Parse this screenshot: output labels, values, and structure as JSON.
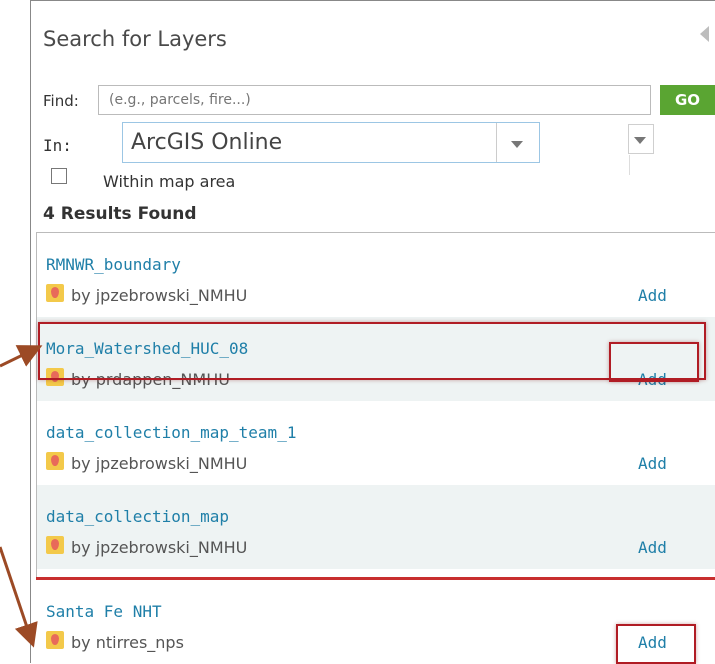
{
  "panel": {
    "title": "Search for Layers",
    "find_label": "Find:",
    "find_placeholder": "(e.g., parcels, fire...)",
    "go_label": "GO",
    "in_label": "In:",
    "in_selected": "ArcGIS Online",
    "within_map_area_label": "Within map area",
    "within_map_area_checked": false,
    "results_count_label": "4 Results Found"
  },
  "results": [
    {
      "title": "RMNWR_boundary",
      "owner": "by jpzebrowski_NMHU",
      "add_label": "Add"
    },
    {
      "title": "Mora_Watershed_HUC_08",
      "owner": "by prdappen_NMHU",
      "add_label": "Add"
    },
    {
      "title": "data_collection_map_team_1",
      "owner": "by jpzebrowski_NMHU",
      "add_label": "Add"
    },
    {
      "title": "data_collection_map",
      "owner": "by jpzebrowski_NMHU",
      "add_label": "Add"
    }
  ],
  "extra_result": {
    "title": "Santa Fe NHT",
    "owner": "by ntirres_nps",
    "add_label": "Add"
  },
  "colors": {
    "accent_link": "#1f7fa8",
    "go_button": "#5aa532",
    "highlight": "#b01c24",
    "arrow": "#9c4a25"
  },
  "icons": {
    "layer_icon": "map-layer-icon",
    "collapse": "collapse-left-icon",
    "dropdown": "chevron-down-icon"
  }
}
